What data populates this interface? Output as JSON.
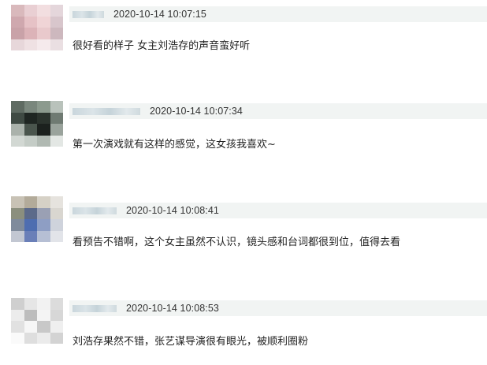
{
  "comments": [
    {
      "timestamp": "2020-10-14 10:07:15",
      "text": "很好看的样子 女主刘浩存的声音蛮好听",
      "avatar_colors": [
        "#d9b9bc",
        "#e9cfd3",
        "#f2dee0",
        "#e4d6db",
        "#cfa8ae",
        "#e6c2c6",
        "#f0d4d6",
        "#d8c6cc",
        "#c9a2a8",
        "#dcb3b8",
        "#e9c9cc",
        "#cdb8be",
        "#e7d7da",
        "#efe1e3",
        "#f5eaec",
        "#eadfe2"
      ]
    },
    {
      "timestamp": "2020-10-14 10:07:34",
      "text": "第一次演戏就有这样的感觉，这女孩我喜欢~",
      "avatar_colors": [
        "#5f6b62",
        "#7a877d",
        "#8c9a8e",
        "#b9c2bb",
        "#3f4a43",
        "#1f2622",
        "#2b332d",
        "#6f7a72",
        "#aab2ab",
        "#4a554d",
        "#1c211e",
        "#9aa39c",
        "#d2d8d3",
        "#c4ccc6",
        "#b0b9b2",
        "#e3e7e4"
      ]
    },
    {
      "timestamp": "2020-10-14 10:08:41",
      "text": "看预告不错啊，这个女主虽然不认识，镜头感和台词都很到位，值得去看",
      "avatar_colors": [
        "#c8c2b5",
        "#b3ab9a",
        "#d6d1c6",
        "#e6e3de",
        "#8b8f7e",
        "#5c6a8a",
        "#9aa0b4",
        "#d9d6d0",
        "#7f8b9c",
        "#4e6db0",
        "#8e9ec4",
        "#cfd3dc",
        "#c2c7d2",
        "#6a7fb8",
        "#b6bfd4",
        "#e2e4e9"
      ]
    },
    {
      "timestamp": "2020-10-14 10:08:53",
      "text": "刘浩存果然不错，张艺谋导演很有眼光，被顺利圈粉",
      "avatar_colors": [
        "#cfcfcf",
        "#e6e6e6",
        "#f2f2f2",
        "#dcdcdc",
        "#ececec",
        "#bdbdbd",
        "#f4f4f4",
        "#d7d7d7",
        "#e1e1e1",
        "#f6f6f6",
        "#c8c8c8",
        "#efefef",
        "#fafafa",
        "#dedede",
        "#ebebeb",
        "#d3d3d3"
      ]
    }
  ]
}
